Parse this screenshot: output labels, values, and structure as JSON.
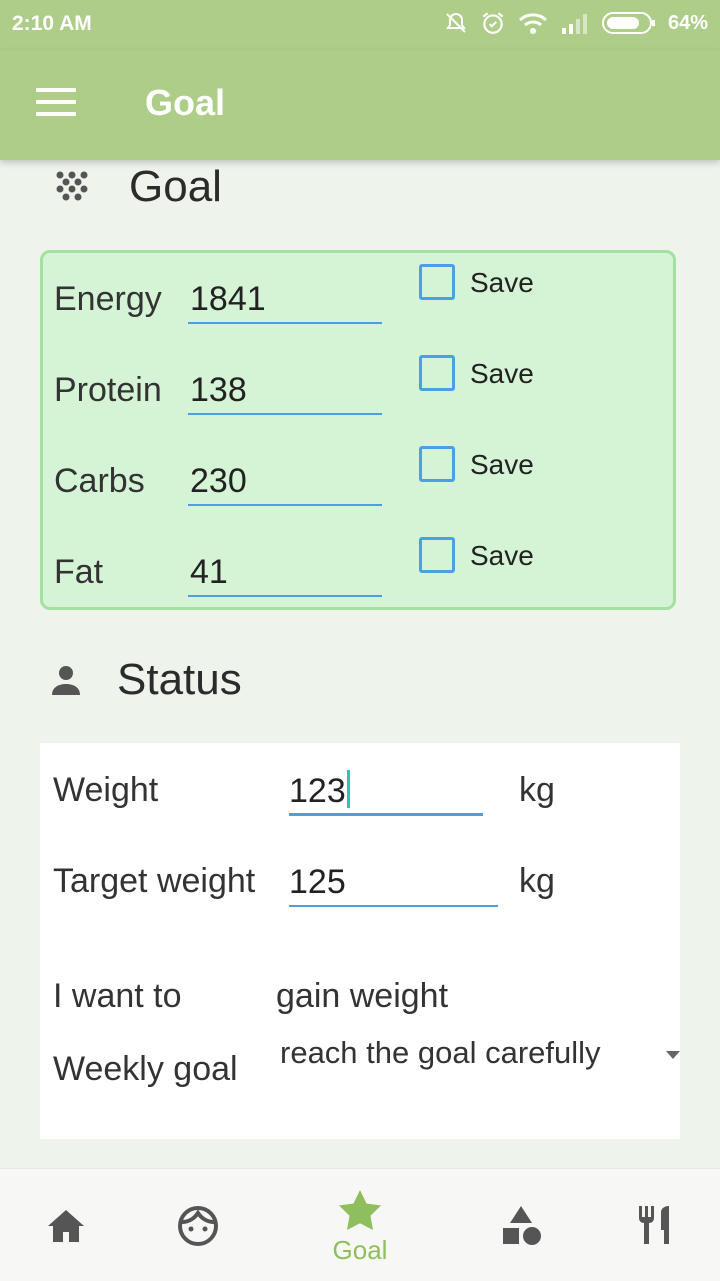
{
  "status_bar": {
    "time": "2:10 AM",
    "battery": "64%"
  },
  "app_bar": {
    "title": "Goal",
    "menu_icon": "menu-icon"
  },
  "goal_section": {
    "title": "Goal",
    "icon": "dots-icon",
    "rows": [
      {
        "label": "Energy",
        "value": "1841",
        "save_label": "Save",
        "checked": false
      },
      {
        "label": "Protein",
        "value": "138",
        "save_label": "Save",
        "checked": false
      },
      {
        "label": "Carbs",
        "value": "230",
        "save_label": "Save",
        "checked": false
      },
      {
        "label": "Fat",
        "value": "41",
        "save_label": "Save",
        "checked": false
      }
    ]
  },
  "status_section": {
    "title": "Status",
    "icon": "person-icon",
    "weight_label": "Weight",
    "weight_value": "123",
    "weight_unit": "kg",
    "target_label": "Target weight",
    "target_value": "125",
    "target_unit": "kg",
    "want_label": "I want to",
    "want_value": "gain weight",
    "weekly_label": "Weekly goal",
    "weekly_value": "reach the goal carefully"
  },
  "bottom_nav": {
    "active_label": "Goal",
    "items": [
      "home-icon",
      "face-icon",
      "star-icon",
      "shapes-icon",
      "restaurant-icon"
    ]
  },
  "colors": {
    "accent": "#aecd88",
    "card": "#d5f4d6",
    "input_line": "#4aa0e2",
    "active_nav": "#8fbf5d"
  }
}
